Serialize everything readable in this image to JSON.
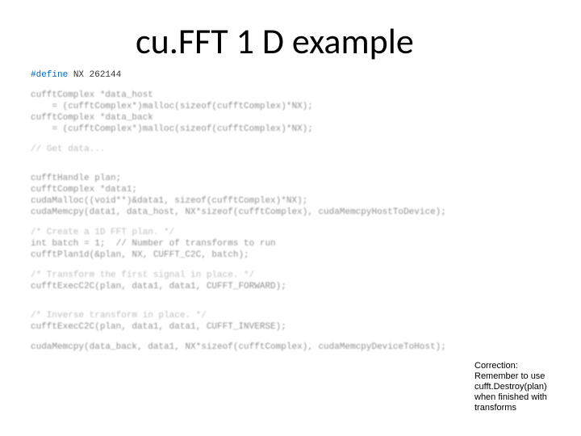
{
  "title": "cu.FFT 1 D example",
  "code": {
    "l00_kw": "#define",
    "l00_rest": " NX 262144",
    "l01": "cufftComplex *data_host",
    "l02": "    = (cufftComplex*)malloc(sizeof(cufftComplex)*NX);",
    "l03": "cufftComplex *data_back",
    "l04": "    = (cufftComplex*)malloc(sizeof(cufftComplex)*NX);",
    "l05": "// Get data...",
    "l06": "cufftHandle plan;",
    "l07": "cufftComplex *data1;",
    "l08": "cudaMalloc((void**)&data1, sizeof(cufftComplex)*NX);",
    "l09": "cudaMemcpy(data1, data_host, NX*sizeof(cufftComplex), cudaMemcpyHostToDevice);",
    "l10": "/* Create a 1D FFT plan. */",
    "l11": "int batch = 1;  // Number of transforms to run",
    "l12": "cufftPlan1d(&plan, NX, CUFFT_C2C, batch);",
    "l13": "/* Transform the first signal in place. */",
    "l14": "cufftExecC2C(plan, data1, data1, CUFFT_FORWARD);",
    "l15": "/* Inverse transform in place. */",
    "l16": "cufftExecC2C(plan, data1, data1, CUFFT_INVERSE);",
    "l17": "cudaMemcpy(data_back, data1, NX*sizeof(cufftComplex), cudaMemcpyDeviceToHost);"
  },
  "note": {
    "n1": "Correction:",
    "n2": "Remember to use",
    "n3": "cufft.Destroy(plan)",
    "n4": "when finished with",
    "n5": "transforms"
  }
}
